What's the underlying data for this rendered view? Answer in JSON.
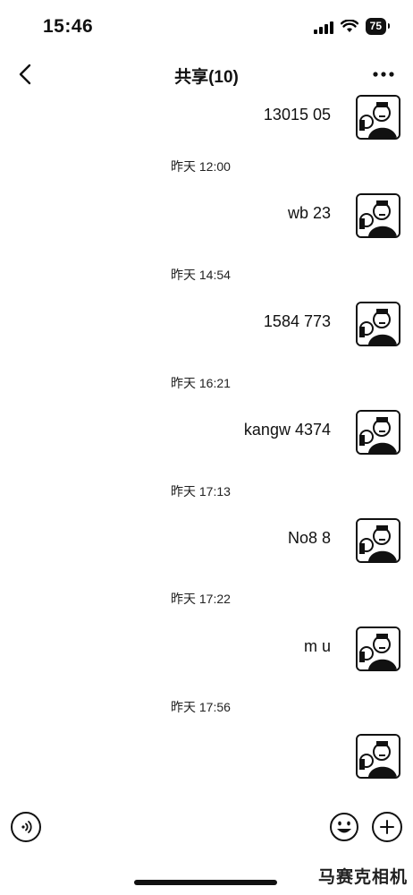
{
  "status_bar": {
    "time": "15:46",
    "battery": "75"
  },
  "nav": {
    "title": "共享(10)"
  },
  "messages": [
    {
      "text": "13015 05"
    },
    {
      "text": "wb 23"
    },
    {
      "text": "1584 773"
    },
    {
      "text": "kangw 4374"
    },
    {
      "text": "No8 8"
    },
    {
      "text": "m u"
    },
    {
      "text": ""
    }
  ],
  "timestamps": [
    "昨天 12:00",
    "昨天 14:54",
    "昨天 16:21",
    "昨天 17:13",
    "昨天 17:22",
    "昨天 17:56"
  ],
  "watermark": "马赛克相机"
}
